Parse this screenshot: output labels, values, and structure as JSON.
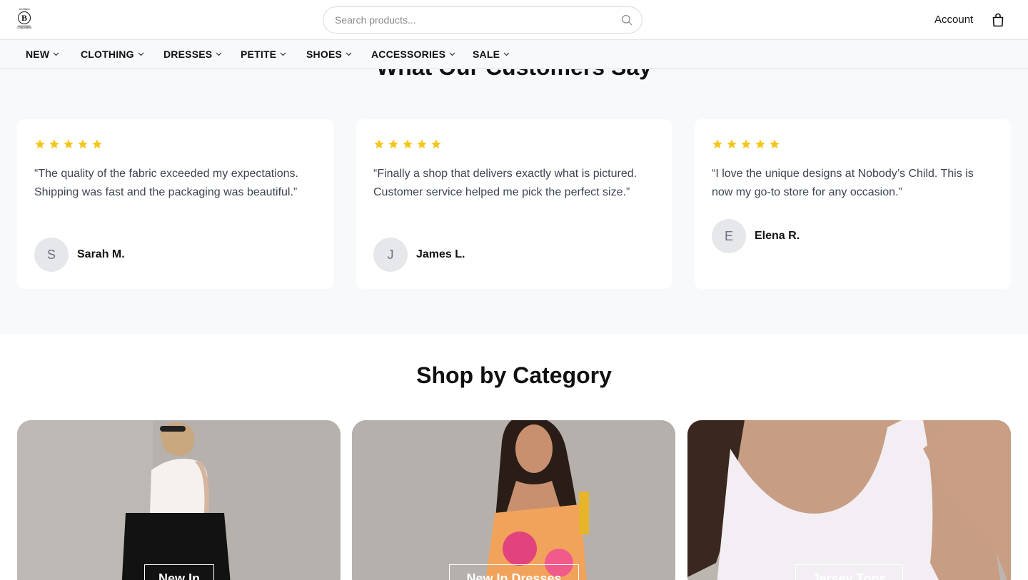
{
  "header": {
    "logo_text": "Certified B Corporation",
    "search_placeholder": "Search products...",
    "account_label": "Account"
  },
  "nav": {
    "items": [
      {
        "label": "NEW"
      },
      {
        "label": "CLOTHING"
      },
      {
        "label": "DRESSES"
      },
      {
        "label": "PETITE"
      },
      {
        "label": "SHOES"
      },
      {
        "label": "ACCESSORIES"
      },
      {
        "label": "SALE"
      }
    ]
  },
  "testimonials": {
    "heading": "What Our Customers Say",
    "star_color": "#f5c518",
    "items": [
      {
        "rating": 5,
        "quote": "“The quality of the fabric exceeded my expectations. Shipping was fast and the packaging was beautiful.”",
        "initial": "S",
        "name": "Sarah M."
      },
      {
        "rating": 5,
        "quote": "“Finally a shop that delivers exactly what is pictured. Customer service helped me pick the perfect size.”",
        "initial": "J",
        "name": "James L."
      },
      {
        "rating": 5,
        "quote": "“I love the unique designs at Nobody’s Child. This is now my go-to store for any occasion.”",
        "initial": "E",
        "name": "Elena R."
      }
    ]
  },
  "categories": {
    "heading": "Shop by Category",
    "items": [
      {
        "label": "New In"
      },
      {
        "label": "New In Dresses"
      },
      {
        "label": "Jersey Tops"
      }
    ]
  }
}
